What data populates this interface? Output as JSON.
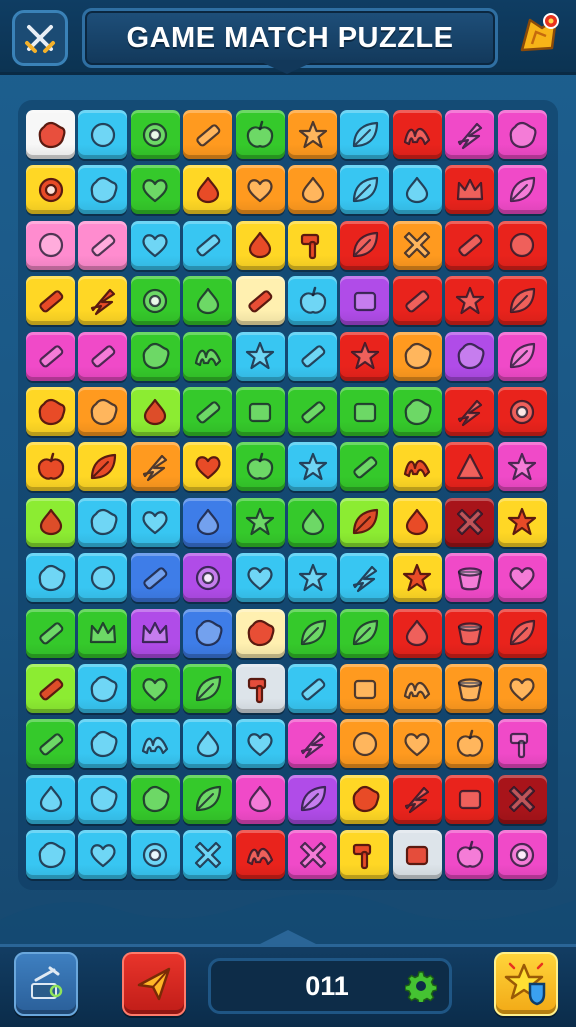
{
  "header": {
    "title": "GAME MATCH PUZZLE",
    "left_button_icon": "crossed-swords-icon",
    "right_button_icon": "gift-star-icon"
  },
  "board": {
    "columns": 10,
    "rows": 14,
    "tiles": [
      {
        "c": "white",
        "i": "blob"
      },
      {
        "c": "sky",
        "i": "circle"
      },
      {
        "c": "green",
        "i": "ring"
      },
      {
        "c": "orange",
        "i": "bar"
      },
      {
        "c": "green",
        "i": "apple"
      },
      {
        "c": "orange",
        "i": "star"
      },
      {
        "c": "sky",
        "i": "leaf"
      },
      {
        "c": "red",
        "i": "wave"
      },
      {
        "c": "magenta",
        "i": "bolt"
      },
      {
        "c": "magenta",
        "i": "blob"
      },
      {
        "c": "yellow",
        "i": "ring"
      },
      {
        "c": "sky",
        "i": "blob"
      },
      {
        "c": "green",
        "i": "heart"
      },
      {
        "c": "yellow",
        "i": "drop"
      },
      {
        "c": "orange",
        "i": "heart"
      },
      {
        "c": "orange",
        "i": "drop"
      },
      {
        "c": "sky",
        "i": "leaf"
      },
      {
        "c": "sky",
        "i": "drop"
      },
      {
        "c": "red",
        "i": "crown"
      },
      {
        "c": "magenta",
        "i": "leaf"
      },
      {
        "c": "pink",
        "i": "circle"
      },
      {
        "c": "pink",
        "i": "bar"
      },
      {
        "c": "sky",
        "i": "heart"
      },
      {
        "c": "sky",
        "i": "bar"
      },
      {
        "c": "yellow",
        "i": "drop"
      },
      {
        "c": "yellow",
        "i": "hammer"
      },
      {
        "c": "red",
        "i": "leaf"
      },
      {
        "c": "orange",
        "i": "cross"
      },
      {
        "c": "red",
        "i": "bar"
      },
      {
        "c": "red",
        "i": "circle"
      },
      {
        "c": "yellow",
        "i": "bar"
      },
      {
        "c": "yellow",
        "i": "bolt"
      },
      {
        "c": "green",
        "i": "ring"
      },
      {
        "c": "green",
        "i": "drop"
      },
      {
        "c": "cream",
        "i": "bar"
      },
      {
        "c": "sky",
        "i": "apple"
      },
      {
        "c": "purple",
        "i": "square"
      },
      {
        "c": "red",
        "i": "bar"
      },
      {
        "c": "red",
        "i": "star"
      },
      {
        "c": "red",
        "i": "leaf"
      },
      {
        "c": "magenta",
        "i": "bar"
      },
      {
        "c": "magenta",
        "i": "bar"
      },
      {
        "c": "green",
        "i": "blob"
      },
      {
        "c": "green",
        "i": "wave"
      },
      {
        "c": "sky",
        "i": "star"
      },
      {
        "c": "sky",
        "i": "bar"
      },
      {
        "c": "red",
        "i": "star"
      },
      {
        "c": "orange",
        "i": "blob"
      },
      {
        "c": "purple",
        "i": "blob"
      },
      {
        "c": "magenta",
        "i": "leaf"
      },
      {
        "c": "yellow",
        "i": "blob"
      },
      {
        "c": "orange",
        "i": "blob"
      },
      {
        "c": "lime",
        "i": "drop"
      },
      {
        "c": "green",
        "i": "bar"
      },
      {
        "c": "green",
        "i": "square"
      },
      {
        "c": "green",
        "i": "bar"
      },
      {
        "c": "green",
        "i": "square"
      },
      {
        "c": "green",
        "i": "blob"
      },
      {
        "c": "red",
        "i": "bolt"
      },
      {
        "c": "red",
        "i": "ring"
      },
      {
        "c": "yellow",
        "i": "apple"
      },
      {
        "c": "yellow",
        "i": "leaf"
      },
      {
        "c": "orange",
        "i": "bolt"
      },
      {
        "c": "yellow",
        "i": "heart"
      },
      {
        "c": "green",
        "i": "apple"
      },
      {
        "c": "sky",
        "i": "star"
      },
      {
        "c": "green",
        "i": "bar"
      },
      {
        "c": "yellow",
        "i": "wave"
      },
      {
        "c": "red",
        "i": "triangle"
      },
      {
        "c": "magenta",
        "i": "star"
      },
      {
        "c": "lime",
        "i": "drop"
      },
      {
        "c": "sky",
        "i": "blob"
      },
      {
        "c": "sky",
        "i": "heart"
      },
      {
        "c": "blue",
        "i": "drop"
      },
      {
        "c": "green",
        "i": "star"
      },
      {
        "c": "green",
        "i": "drop"
      },
      {
        "c": "lime",
        "i": "leaf"
      },
      {
        "c": "yellow",
        "i": "drop"
      },
      {
        "c": "darkred",
        "i": "cross"
      },
      {
        "c": "yellow",
        "i": "star"
      },
      {
        "c": "sky",
        "i": "blob"
      },
      {
        "c": "sky",
        "i": "circle"
      },
      {
        "c": "blue",
        "i": "bar"
      },
      {
        "c": "purple",
        "i": "ring"
      },
      {
        "c": "sky",
        "i": "heart"
      },
      {
        "c": "sky",
        "i": "star"
      },
      {
        "c": "sky",
        "i": "bolt"
      },
      {
        "c": "yellow",
        "i": "star"
      },
      {
        "c": "magenta",
        "i": "cup"
      },
      {
        "c": "magenta",
        "i": "heart"
      },
      {
        "c": "green",
        "i": "bar"
      },
      {
        "c": "green",
        "i": "crown"
      },
      {
        "c": "purple",
        "i": "crown"
      },
      {
        "c": "blue",
        "i": "blob"
      },
      {
        "c": "cream",
        "i": "blob"
      },
      {
        "c": "green",
        "i": "leaf"
      },
      {
        "c": "green",
        "i": "leaf"
      },
      {
        "c": "red",
        "i": "drop"
      },
      {
        "c": "red",
        "i": "cup"
      },
      {
        "c": "red",
        "i": "leaf"
      },
      {
        "c": "lime",
        "i": "bar"
      },
      {
        "c": "sky",
        "i": "blob"
      },
      {
        "c": "green",
        "i": "heart"
      },
      {
        "c": "green",
        "i": "leaf"
      },
      {
        "c": "silver",
        "i": "hammer"
      },
      {
        "c": "sky",
        "i": "bar"
      },
      {
        "c": "orange",
        "i": "square"
      },
      {
        "c": "orange",
        "i": "wave"
      },
      {
        "c": "orange",
        "i": "cup"
      },
      {
        "c": "orange",
        "i": "heart"
      },
      {
        "c": "green",
        "i": "bar"
      },
      {
        "c": "sky",
        "i": "blob"
      },
      {
        "c": "sky",
        "i": "wave"
      },
      {
        "c": "sky",
        "i": "drop"
      },
      {
        "c": "sky",
        "i": "heart"
      },
      {
        "c": "magenta",
        "i": "bolt"
      },
      {
        "c": "orange",
        "i": "circle"
      },
      {
        "c": "orange",
        "i": "heart"
      },
      {
        "c": "orange",
        "i": "apple"
      },
      {
        "c": "magenta",
        "i": "hammer"
      },
      {
        "c": "sky",
        "i": "drop"
      },
      {
        "c": "sky",
        "i": "blob"
      },
      {
        "c": "green",
        "i": "blob"
      },
      {
        "c": "green",
        "i": "leaf"
      },
      {
        "c": "magenta",
        "i": "drop"
      },
      {
        "c": "purple",
        "i": "leaf"
      },
      {
        "c": "yellow",
        "i": "blob"
      },
      {
        "c": "red",
        "i": "bolt"
      },
      {
        "c": "red",
        "i": "square"
      },
      {
        "c": "darkred",
        "i": "cross"
      },
      {
        "c": "sky",
        "i": "blob"
      },
      {
        "c": "sky",
        "i": "heart"
      },
      {
        "c": "sky",
        "i": "ring"
      },
      {
        "c": "sky",
        "i": "cross"
      },
      {
        "c": "red",
        "i": "wave"
      },
      {
        "c": "magenta",
        "i": "cross"
      },
      {
        "c": "yellow",
        "i": "hammer"
      },
      {
        "c": "silver",
        "i": "square"
      },
      {
        "c": "magenta",
        "i": "apple"
      },
      {
        "c": "magenta",
        "i": "ring"
      }
    ]
  },
  "tile_colors": {
    "white": "#f7f7f7",
    "sky": "#38c6f2",
    "green": "#35c92b",
    "orange": "#ff9a1f",
    "red": "#e9231c",
    "magenta": "#f04ac8",
    "yellow": "#ffd725",
    "pink": "#ff8ccf",
    "purple": "#b04ce8",
    "cream": "#fff0b0",
    "lime": "#8cec32",
    "blue": "#3e7de8",
    "darkred": "#a8141a",
    "silver": "#dde4ea"
  },
  "footer": {
    "counter_value": "011",
    "counter_icon": "gear-icon",
    "buttons": [
      "pickaxe-hint-icon",
      "paper-plane-icon",
      "star-shield-icon"
    ]
  }
}
